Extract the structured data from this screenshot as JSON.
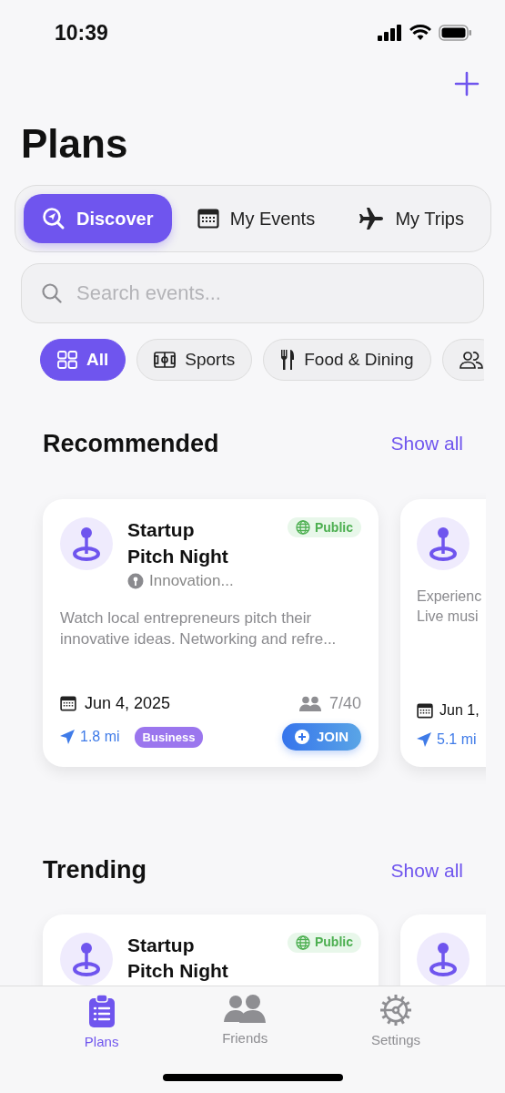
{
  "status_bar": {
    "time": "10:39"
  },
  "title": "Plans",
  "segments": [
    {
      "kind": "discover",
      "label": "Discover",
      "selected": true
    },
    {
      "kind": "events",
      "label": "My Events",
      "selected": false
    },
    {
      "kind": "trips",
      "label": "My Trips",
      "selected": false
    }
  ],
  "search": {
    "placeholder": "Search events..."
  },
  "filters": [
    {
      "kind": "all",
      "label": "All",
      "selected": true
    },
    {
      "kind": "sports",
      "label": "Sports",
      "selected": false
    },
    {
      "kind": "food",
      "label": "Food & Dining",
      "selected": false
    },
    {
      "kind": "social",
      "selected": false
    }
  ],
  "sections": [
    {
      "title": "Recommended",
      "action": "Show all",
      "cards": [
        {
          "kind": "event",
          "title": "Startup Pitch Night",
          "visibility": "Public",
          "venue": "Innovation...",
          "description": [
            "Watch local entrepreneurs pitch their",
            "innovative ideas. Networking and refre..."
          ],
          "date": "Jun 4, 2025",
          "attendees": "7/40",
          "distance": "1.8 mi",
          "category": "Business",
          "join": "JOIN"
        },
        {
          "kind": "event",
          "description": [
            "Experienc",
            "Live musi"
          ],
          "date": "Jun 1,",
          "distance": "5.1 mi"
        }
      ]
    },
    {
      "title": "Trending",
      "action": "Show all",
      "cards": [
        {
          "kind": "event",
          "title": "Startup Pitch Night",
          "visibility": "Public"
        },
        {
          "kind": "event"
        }
      ]
    }
  ],
  "tab_bar": [
    {
      "kind": "plans",
      "label": "Plans",
      "selected": true
    },
    {
      "kind": "friends",
      "label": "Friends",
      "selected": false
    },
    {
      "kind": "settings",
      "label": "Settings",
      "selected": false
    }
  ]
}
